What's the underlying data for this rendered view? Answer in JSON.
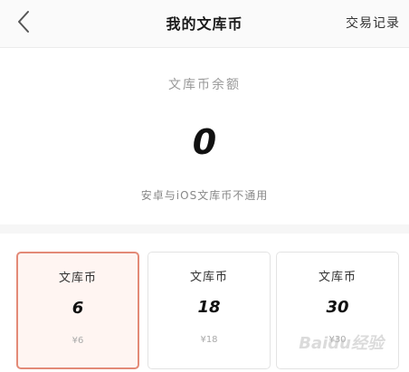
{
  "nav": {
    "title": "我的文库币",
    "right_link": "交易记录",
    "back_icon": "chevron-left-icon"
  },
  "balance": {
    "label": "文库币余额",
    "amount": "0",
    "note": "安卓与iOS文库币不通用"
  },
  "packages": [
    {
      "name": "文库币",
      "amount": "6",
      "price": "¥6",
      "selected": true
    },
    {
      "name": "文库币",
      "amount": "18",
      "price": "¥18",
      "selected": false
    },
    {
      "name": "文库币",
      "amount": "30",
      "price": "¥30",
      "selected": false
    }
  ],
  "watermark": "Baidu经验",
  "colors": {
    "selected_border": "#e38a77",
    "selected_bg": "#fff5f2"
  }
}
